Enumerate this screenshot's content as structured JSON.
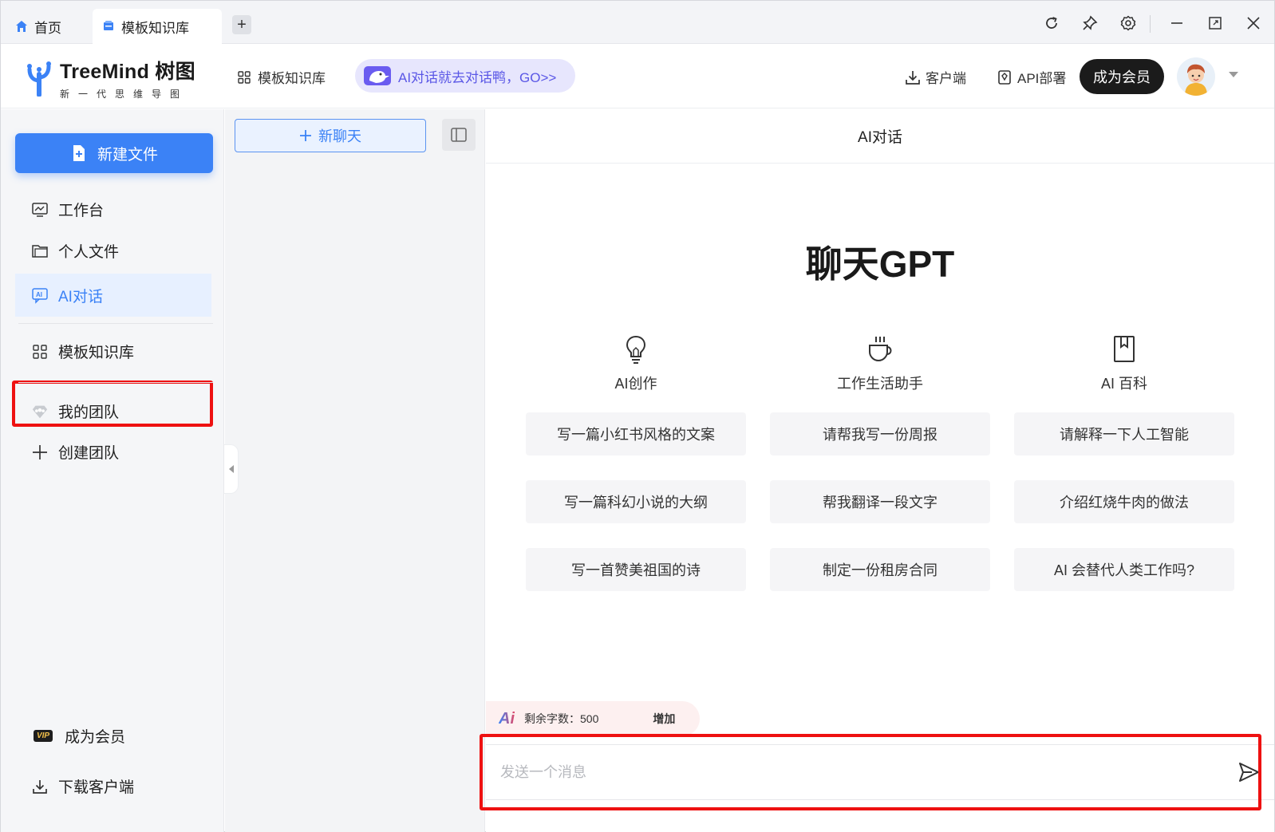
{
  "tabs": [
    {
      "label": "首页"
    },
    {
      "label": "模板知识库"
    }
  ],
  "tab_add": "+",
  "window_controls": [
    "refresh-icon",
    "pin-icon",
    "gear-icon",
    "minimize-icon",
    "restore-icon",
    "close-icon"
  ],
  "header": {
    "logo_title": "TreeMind 树图",
    "logo_subtitle": "新一代思维导图",
    "nav_template": "模板知识库",
    "promo": "AI对话就去对话鸭，GO>>",
    "client_label": "客户端",
    "api_label": "API部署",
    "member_label": "成为会员"
  },
  "sidebar": {
    "new_file": "新建文件",
    "items": [
      {
        "label": "工作台",
        "icon": "monitor-icon"
      },
      {
        "label": "个人文件",
        "icon": "folder-icon"
      },
      {
        "label": "AI对话",
        "icon": "ai-chat-icon"
      },
      {
        "label": "模板知识库",
        "icon": "grid-icon"
      },
      {
        "label": "我的团队",
        "icon": "team-icon"
      },
      {
        "label": "创建团队",
        "icon": "plus-icon"
      }
    ],
    "vip_badge": "VIP",
    "become_member": "成为会员",
    "download_client": "下载客户端"
  },
  "chat_list": {
    "new_chat": "新聊天"
  },
  "main": {
    "title": "AI对话",
    "hero": "聊天GPT",
    "categories": [
      {
        "label": "AI创作",
        "icon": "lightbulb-icon"
      },
      {
        "label": "工作生活助手",
        "icon": "coffee-cup-icon"
      },
      {
        "label": "AI 百科",
        "icon": "bookmark-book-icon"
      }
    ],
    "suggestions": [
      [
        "写一篇小红书风格的文案",
        "请帮我写一份周报",
        "请解释一下人工智能"
      ],
      [
        "写一篇科幻小说的大纲",
        "帮我翻译一段文字",
        "介绍红烧牛肉的做法"
      ],
      [
        "写一首赞美祖国的诗",
        "制定一份租房合同",
        "AI 会替代人类工作吗?"
      ]
    ],
    "quota_ai": "Ai",
    "quota_label": "剩余字数：500",
    "quota_add": "增加",
    "input_placeholder": "发送一个消息"
  },
  "colors": {
    "accent": "#3b82f6",
    "highlight_box": "#ee1111",
    "member_button": "#1b1b1b"
  }
}
